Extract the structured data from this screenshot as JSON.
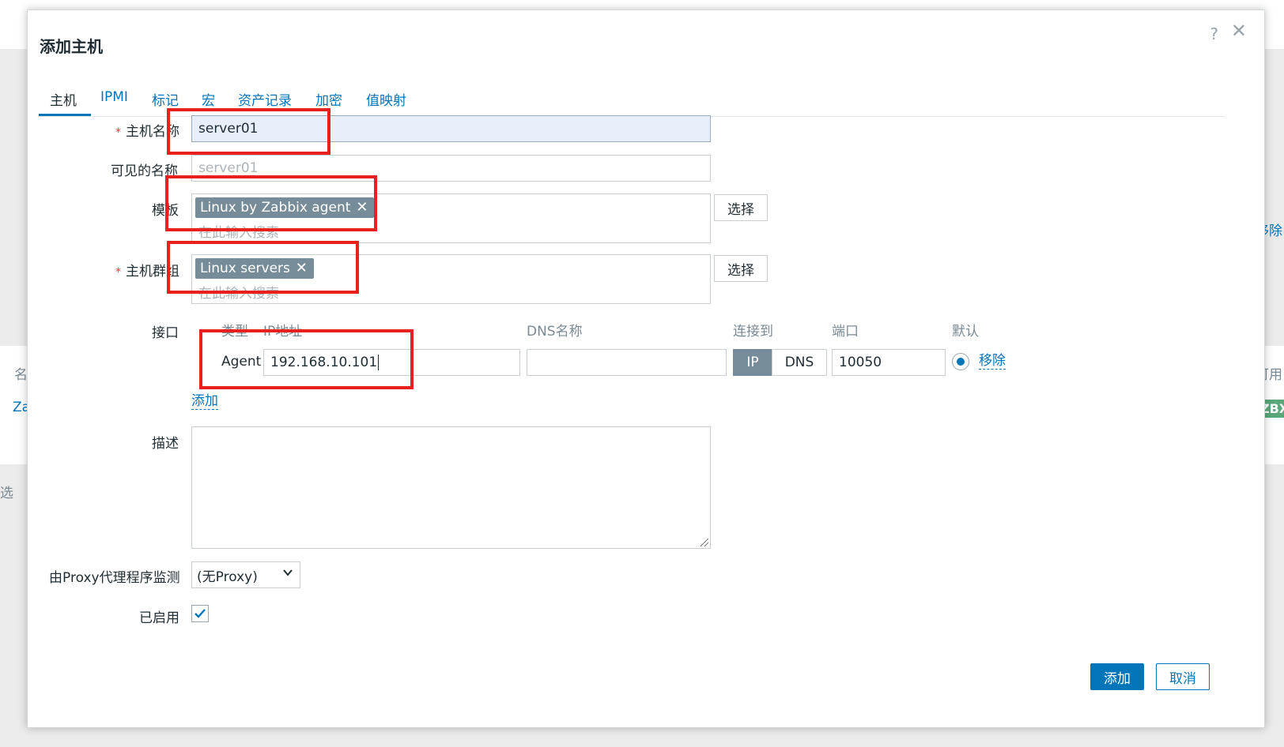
{
  "background": {
    "left_col_header": "名",
    "left_row_text": "Za",
    "left_filter_text": "选",
    "right_link": "移除",
    "right_col_header": "可用",
    "right_badge": "ZBX"
  },
  "dialog": {
    "title": "添加主机",
    "help_icon": "?",
    "close_icon": "✕"
  },
  "tabs": [
    "主机",
    "IPMI",
    "标记",
    "宏",
    "资产记录",
    "加密",
    "值映射"
  ],
  "form": {
    "host_name": {
      "label": "主机名称",
      "required_mark": "*",
      "value": "server01"
    },
    "visible_name": {
      "label": "可见的名称",
      "placeholder": "server01"
    },
    "templates": {
      "label": "模板",
      "chip": "Linux by Zabbix agent",
      "chip_remove": "✕",
      "placeholder": "在此输入搜索",
      "select_button": "选择"
    },
    "host_groups": {
      "label": "主机群组",
      "required_mark": "*",
      "chip": "Linux servers",
      "chip_remove": "✕",
      "placeholder": "在此输入搜索",
      "select_button": "选择"
    },
    "interfaces": {
      "label": "接口",
      "headers": {
        "type": "类型",
        "ip": "IP地址",
        "dns": "DNS名称",
        "connect_to": "连接到",
        "port": "端口",
        "default": "默认"
      },
      "row": {
        "type": "Agent",
        "ip": "192.168.10.101",
        "dns": "",
        "connect_ip": "IP",
        "connect_dns": "DNS",
        "port": "10050",
        "remove": "移除"
      },
      "add_link": "添加"
    },
    "description": {
      "label": "描述",
      "value": ""
    },
    "proxy": {
      "label": "由Proxy代理程序监测",
      "selected": "(无Proxy)"
    },
    "enabled": {
      "label": "已启用",
      "checked": true
    }
  },
  "footer": {
    "add_button": "添加",
    "cancel_button": "取消"
  },
  "colors": {
    "accent": "#0275b8",
    "chip": "#768d99",
    "highlight_box": "#e8201e",
    "required": "#e33734"
  }
}
